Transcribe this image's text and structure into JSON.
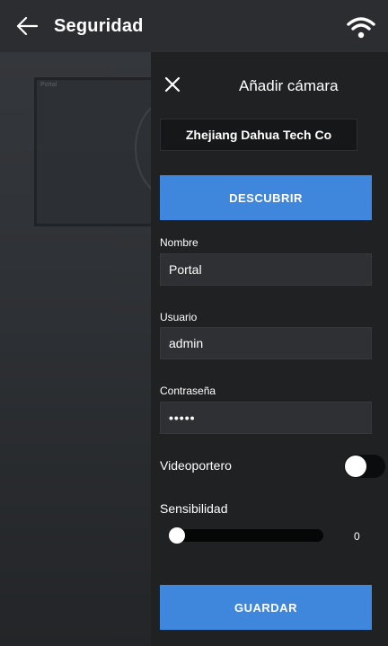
{
  "header": {
    "title": "Seguridad",
    "back_icon": "arrow-left-icon",
    "wifi_icon": "wifi-icon"
  },
  "background": {
    "card_label": "Portal"
  },
  "dialog": {
    "title": "Añadir cámara",
    "close_icon": "close-icon",
    "brand": "Zhejiang Dahua Tech Co",
    "discover_label": "DESCUBRIR",
    "fields": {
      "name": {
        "label": "Nombre",
        "value": "Portal"
      },
      "user": {
        "label": "Usuario",
        "value": "admin"
      },
      "password": {
        "label": "Contraseña",
        "value": "•••••"
      }
    },
    "intercom": {
      "label": "Videoportero",
      "enabled": false
    },
    "sensitivity": {
      "label": "Sensibilidad",
      "value": "0"
    },
    "save_label": "GUARDAR"
  },
  "colors": {
    "accent": "#3f86dd",
    "panel": "#1f2123",
    "topbar": "#2b2d30"
  }
}
